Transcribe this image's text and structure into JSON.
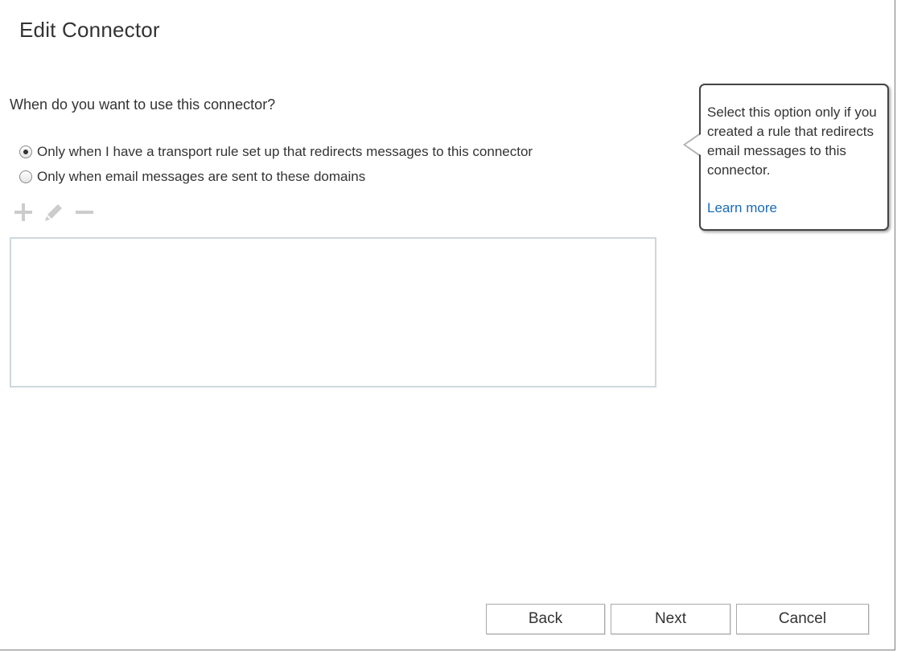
{
  "dialog": {
    "title": "Edit Connector",
    "question": "When do you want to use this connector?"
  },
  "options": [
    {
      "label": "Only when I have a transport rule set up that redirects messages to this connector",
      "selected": true
    },
    {
      "label": "Only when email messages are sent to these domains",
      "selected": false
    }
  ],
  "toolbar": {
    "add_icon": "plus-icon",
    "edit_icon": "pencil-icon",
    "remove_icon": "minus-icon",
    "disabled_color": "#cccccc"
  },
  "callout": {
    "text": "Select this option only if you created a rule that redirects email messages to this connector.",
    "link": "Learn more",
    "link_color": "#1a6bb3"
  },
  "buttons": {
    "back": "Back",
    "next": "Next",
    "cancel": "Cancel"
  }
}
